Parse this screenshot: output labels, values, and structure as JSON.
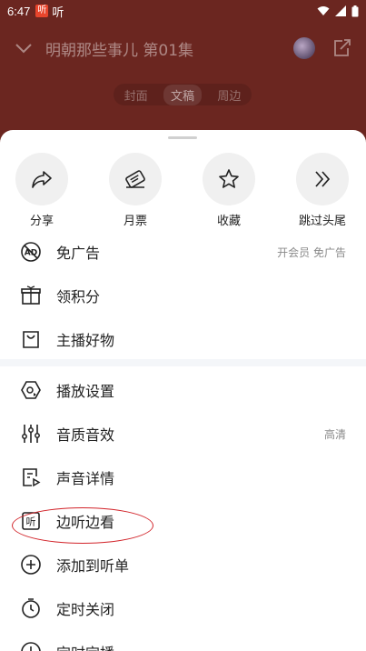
{
  "status": {
    "time": "6:47",
    "app_badge": "听",
    "app_text": "听"
  },
  "header": {
    "title": "明朝那些事儿 第01集"
  },
  "segments": [
    "封面",
    "文稿",
    "周边"
  ],
  "quick_actions": [
    {
      "label": "分享",
      "icon": "share-icon"
    },
    {
      "label": "月票",
      "icon": "ticket-icon"
    },
    {
      "label": "收藏",
      "icon": "star-icon"
    },
    {
      "label": "跳过头尾",
      "icon": "skip-icon"
    }
  ],
  "menu_group1": [
    {
      "label": "免广告",
      "right": "开会员 免广告",
      "icon": "no-ad-icon"
    },
    {
      "label": "领积分",
      "right": "",
      "icon": "gift-icon"
    },
    {
      "label": "主播好物",
      "right": "",
      "icon": "shopping-bag-icon"
    }
  ],
  "menu_group2": [
    {
      "label": "播放设置",
      "right": "",
      "icon": "play-settings-icon"
    },
    {
      "label": "音质音效",
      "right": "高清",
      "icon": "equalizer-icon"
    },
    {
      "label": "声音详情",
      "right": "",
      "icon": "document-play-icon"
    },
    {
      "label": "边听边看",
      "right": "",
      "icon": "listen-watch-icon"
    },
    {
      "label": "添加到听单",
      "right": "",
      "icon": "plus-circle-icon"
    },
    {
      "label": "定时关闭",
      "right": "",
      "icon": "timer-icon"
    },
    {
      "label": "定时定播",
      "right": "",
      "icon": "clock-icon"
    }
  ],
  "colors": {
    "background": "#6b2620",
    "highlight": "#d2242a"
  }
}
